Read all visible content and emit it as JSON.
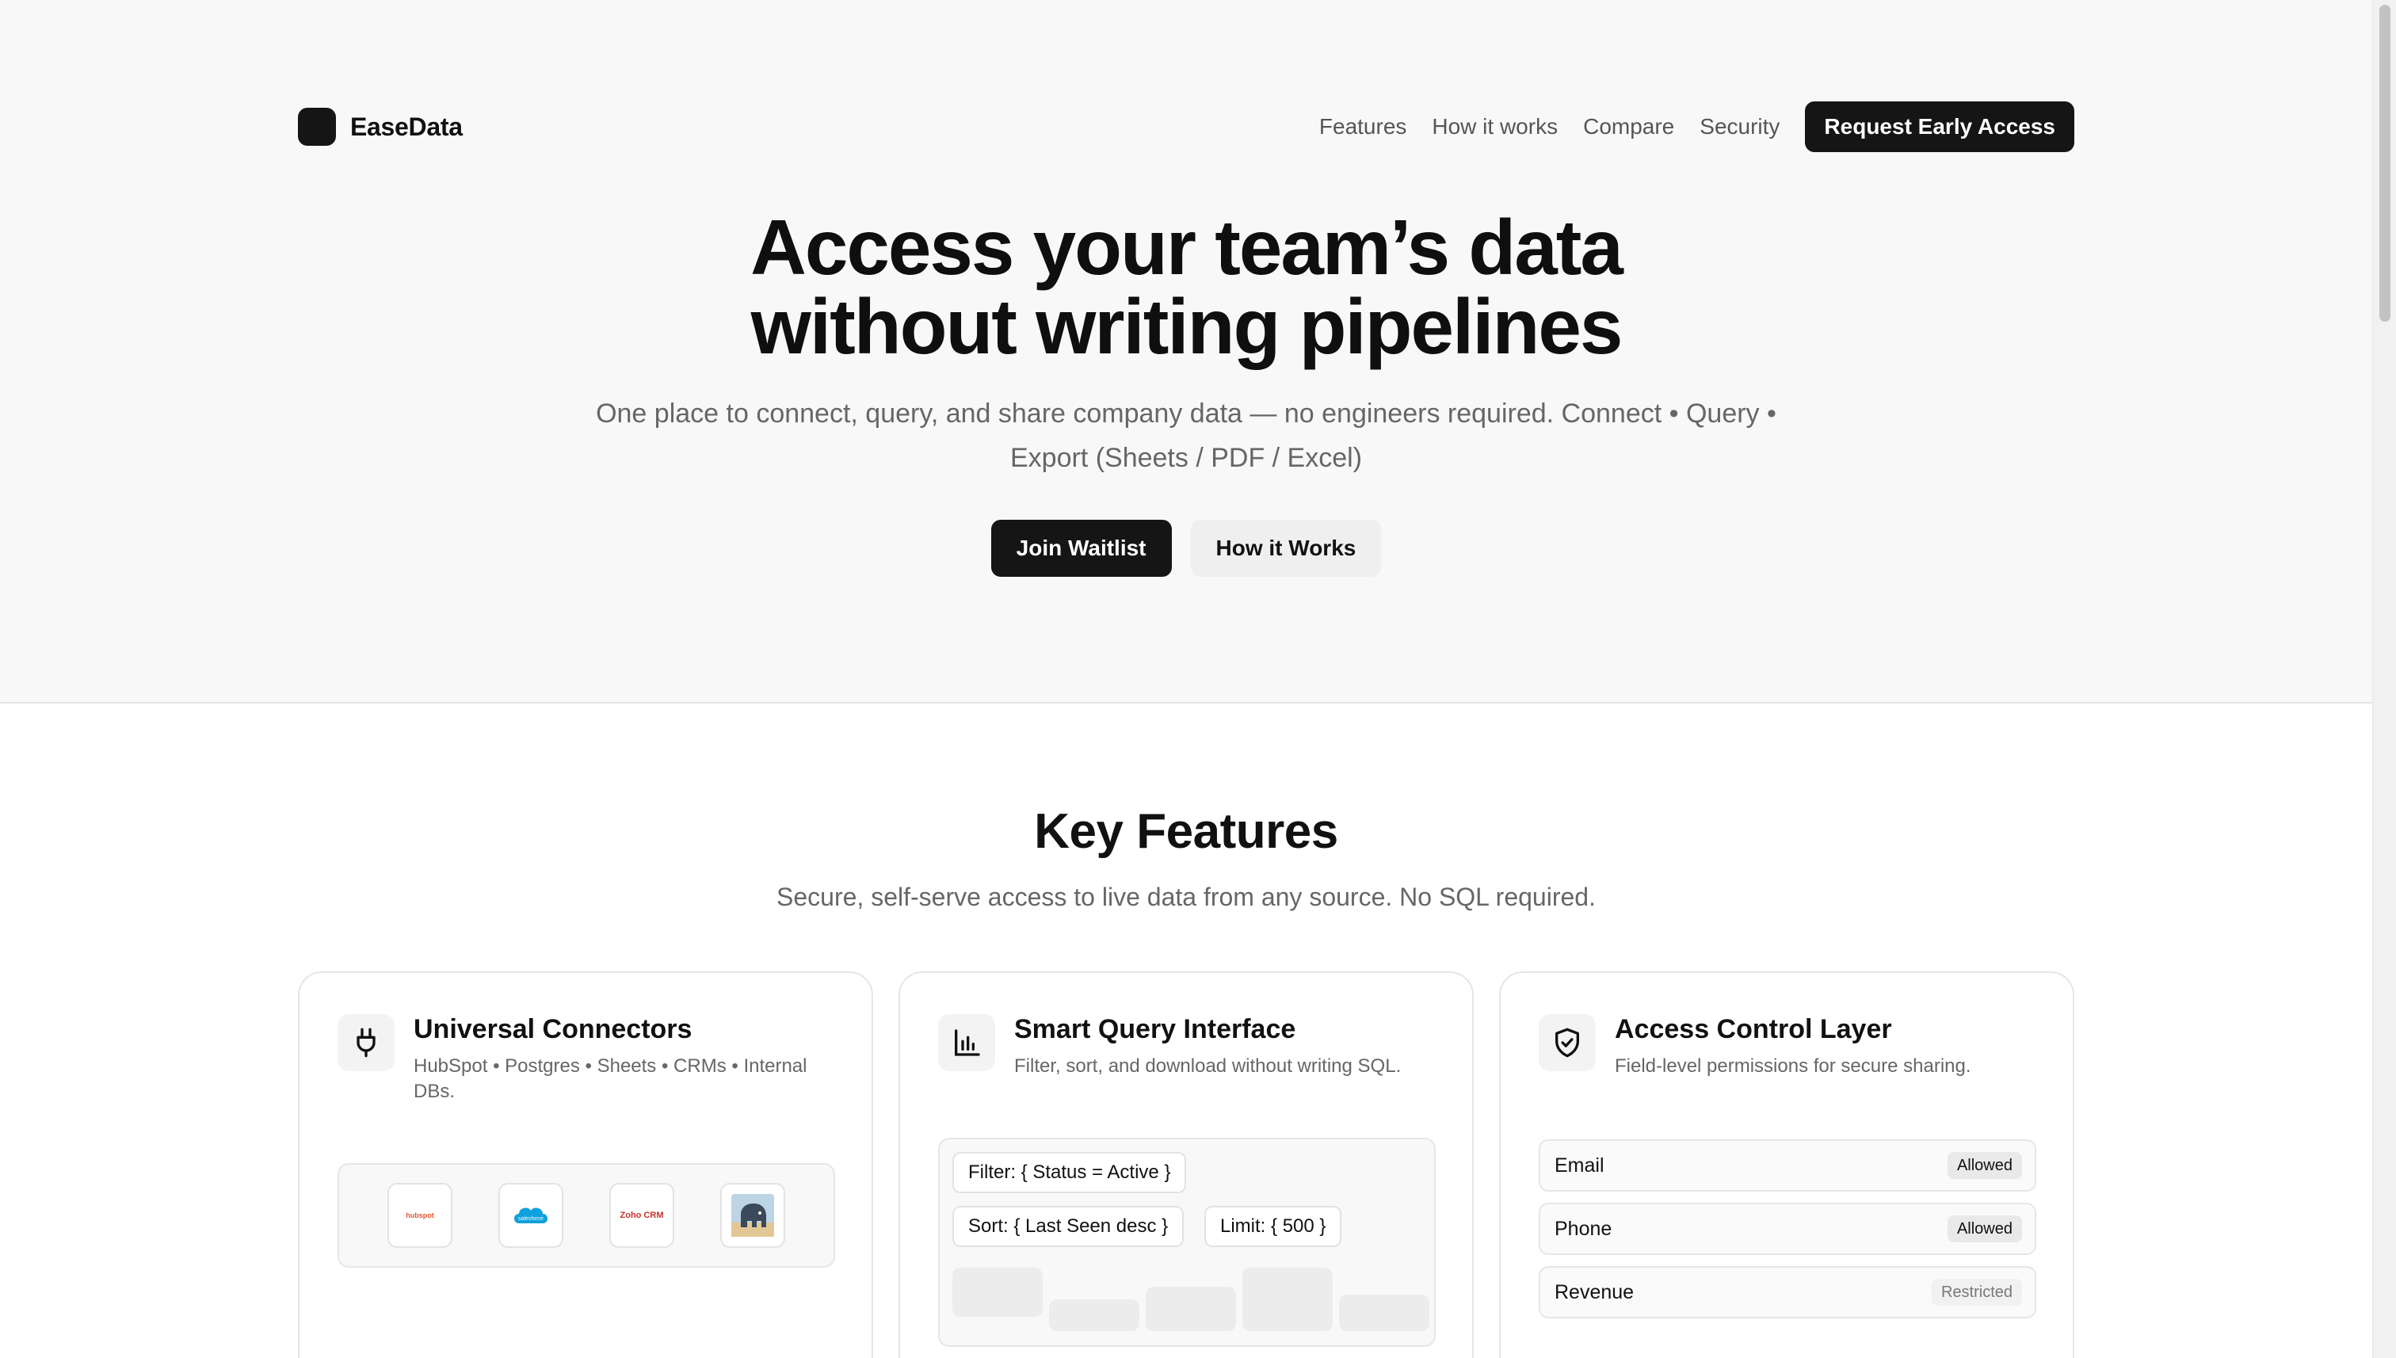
{
  "brand": {
    "name": "EaseData"
  },
  "nav": {
    "links": [
      "Features",
      "How it works",
      "Compare",
      "Security"
    ],
    "cta": "Request Early Access"
  },
  "hero": {
    "title_line1": "Access your team’s data",
    "title_line2": "without writing pipelines",
    "subtitle": "One place to connect, query, and share company data — no engineers required. Connect • Query • Export (Sheets / PDF / Excel)",
    "primary_button": "Join Waitlist",
    "secondary_button": "How it Works"
  },
  "features": {
    "title": "Key Features",
    "subtitle": "Secure, self-serve access to live data from any source. No SQL required.",
    "cards": [
      {
        "title": "Universal Connectors",
        "description": "HubSpot • Postgres • Sheets • CRMs • Internal DBs.",
        "icon": "plug-icon",
        "logos": [
          "hubspot",
          "salesforce",
          "Zoho CRM",
          "postgres"
        ]
      },
      {
        "title": "Smart Query Interface",
        "description": "Filter, sort, and download without writing SQL.",
        "icon": "bar-chart-icon",
        "chips": [
          "Filter: { Status = Active }",
          "Sort: { Last Seen desc }",
          "Limit: { 500 }"
        ]
      },
      {
        "title": "Access Control Layer",
        "description": "Field-level permissions for secure sharing.",
        "icon": "shield-check-icon",
        "fields": [
          {
            "name": "Email",
            "status": "Allowed"
          },
          {
            "name": "Phone",
            "status": "Allowed"
          },
          {
            "name": "Revenue",
            "status": "Restricted"
          }
        ]
      }
    ]
  },
  "colors": {
    "primary": "#151515",
    "hero_bg": "#f8f8f8",
    "muted_text": "#666666"
  }
}
